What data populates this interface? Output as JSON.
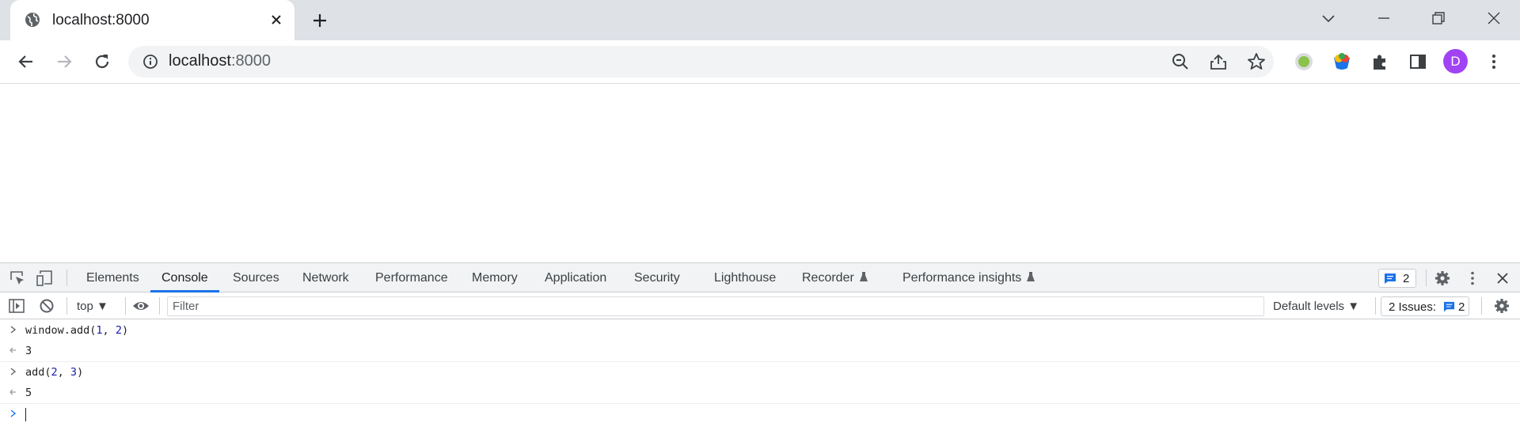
{
  "browser": {
    "tab": {
      "title": "localhost:8000",
      "favicon": "globe-icon"
    },
    "address_bar": {
      "host": "localhost",
      "port_suffix": ":8000"
    },
    "profile_initial": "D",
    "accent_color": "#1a73e8",
    "avatar_color": "#a142f4"
  },
  "devtools": {
    "tabs": [
      {
        "label": "Elements"
      },
      {
        "label": "Console",
        "active": true
      },
      {
        "label": "Sources"
      },
      {
        "label": "Network"
      },
      {
        "label": "Performance"
      },
      {
        "label": "Memory"
      },
      {
        "label": "Application"
      },
      {
        "label": "Security"
      },
      {
        "label": "Lighthouse"
      },
      {
        "label": "Recorder",
        "experimental": true
      },
      {
        "label": "Performance insights",
        "experimental": true
      }
    ],
    "messages_count": "2",
    "console_toolbar": {
      "context": "top",
      "filter_placeholder": "Filter",
      "levels": "Default levels",
      "issues_label": "2 Issues:",
      "issues_count": "2"
    },
    "console": [
      {
        "kind": "input",
        "pre": "window.add(",
        "a": "1",
        "sep": ", ",
        "b": "2",
        "post": ")"
      },
      {
        "kind": "result",
        "value": "3"
      },
      {
        "kind": "input",
        "pre": "add(",
        "a": "2",
        "sep": ", ",
        "b": "3",
        "post": ")"
      },
      {
        "kind": "result",
        "value": "5"
      }
    ]
  }
}
